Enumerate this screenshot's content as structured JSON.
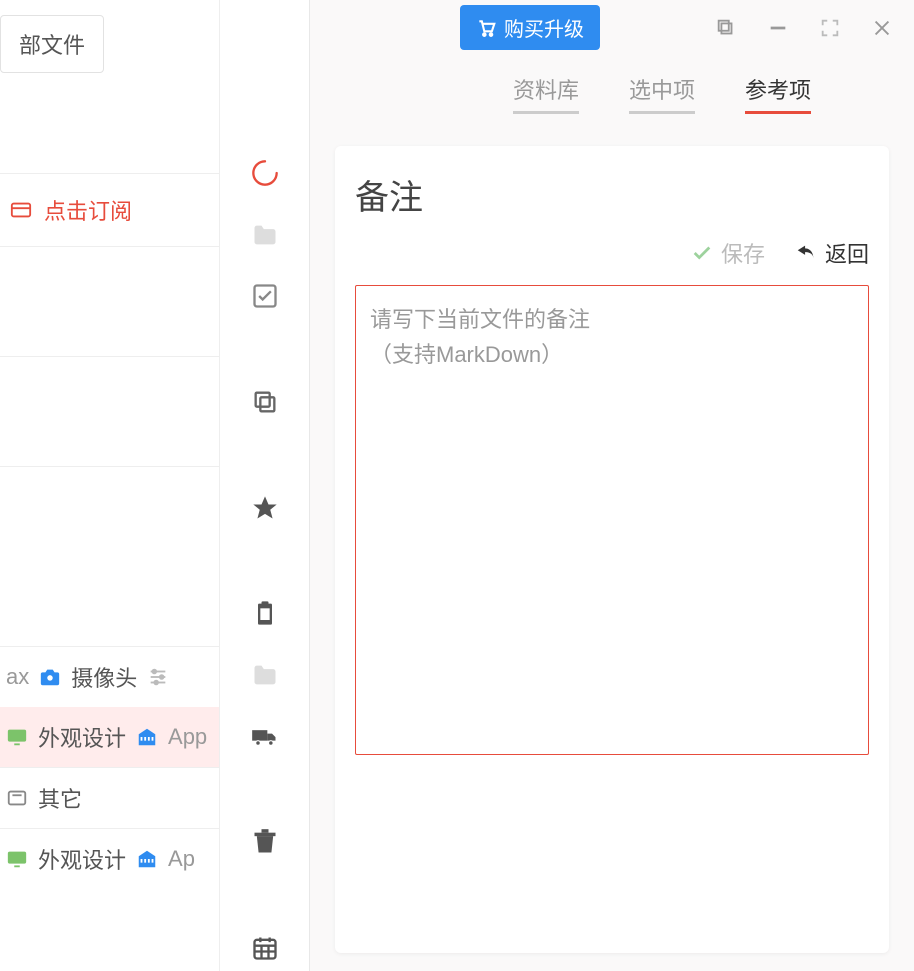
{
  "left": {
    "file_button": "部文件",
    "subscribe": "点击订阅",
    "cam_prefix": "ax",
    "camera_label": "摄像头",
    "design_label": "外观设计",
    "app_label": "App",
    "other_label": "其它",
    "design2_label": "外观设计",
    "app2_label": "Ap"
  },
  "toolbar": {
    "items": [
      "loading",
      "folder",
      "check",
      "copy",
      "star",
      "clipboard",
      "folder2",
      "truck",
      "trash",
      "calendar"
    ]
  },
  "right": {
    "upgrade": "购买升级",
    "tabs": {
      "library": "资料库",
      "selected": "选中项",
      "reference": "参考项"
    },
    "note_title": "备注",
    "save_label": "保存",
    "back_label": "返回",
    "placeholder": "请写下当前文件的备注\n（支持MarkDown）"
  }
}
